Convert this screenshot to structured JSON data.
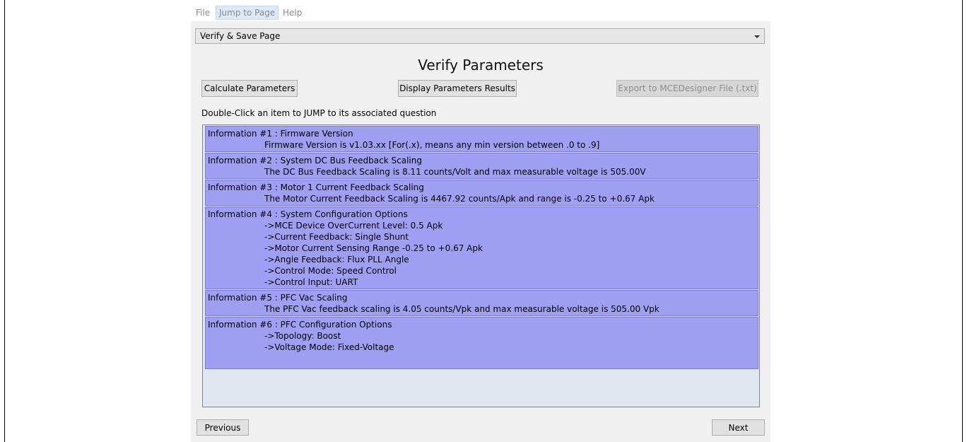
{
  "menubar": {
    "items": [
      {
        "label": "File"
      },
      {
        "label": "Jump to Page"
      },
      {
        "label": "Help"
      }
    ]
  },
  "page_selector": {
    "value": "Verify & Save Page",
    "icon": "chevron-down-icon"
  },
  "page": {
    "title": "Verify Parameters",
    "buttons": {
      "calculate": "Calculate Parameters",
      "display": "Display Parameters Results",
      "export": "Export to MCEDesigner File (.txt)"
    },
    "instruction": "Double-Click an item to JUMP to its associated question"
  },
  "info_list": {
    "items": [
      {
        "title": "Information #1 : Firmware Version",
        "lines": [
          "Firmware Version is v1.03.xx [For(.x), means any min version between .0 to .9]"
        ]
      },
      {
        "title": "Information #2 : System DC Bus Feedback Scaling",
        "lines": [
          "The DC Bus Feedback Scaling is 8.11 counts/Volt and max measurable voltage is 505.00V"
        ]
      },
      {
        "title": "Information #3 : Motor 1 Current Feedback Scaling",
        "lines": [
          "The Motor Current Feedback Scaling is 4467.92 counts/Apk and range is -0.25 to +0.67 Apk"
        ]
      },
      {
        "title": "Information #4 : System Configuration Options",
        "lines": [
          "->MCE Device OverCurrent Level:  0.5 Apk",
          "->Current Feedback:  Single Shunt",
          "->Motor Current Sensing Range  -0.25 to +0.67 Apk",
          "->Angle Feedback: Flux PLL Angle",
          "->Control Mode: Speed Control",
          "->Control Input: UART"
        ]
      },
      {
        "title": "Information #5 : PFC Vac Scaling",
        "lines": [
          "The PFC Vac feedback scaling is 4.05 counts/Vpk and max measurable voltage is 505.00 Vpk"
        ]
      },
      {
        "title": "Information #6 : PFC Configuration Options",
        "lines": [
          "->Topology:  Boost",
          "->Voltage Mode: Fixed-Voltage"
        ]
      }
    ]
  },
  "footer": {
    "previous": "Previous",
    "next": "Next"
  },
  "colors": {
    "item_background": "#9e9ef3",
    "list_background": "#dfe6ef",
    "window_background": "#f0f0f0"
  }
}
